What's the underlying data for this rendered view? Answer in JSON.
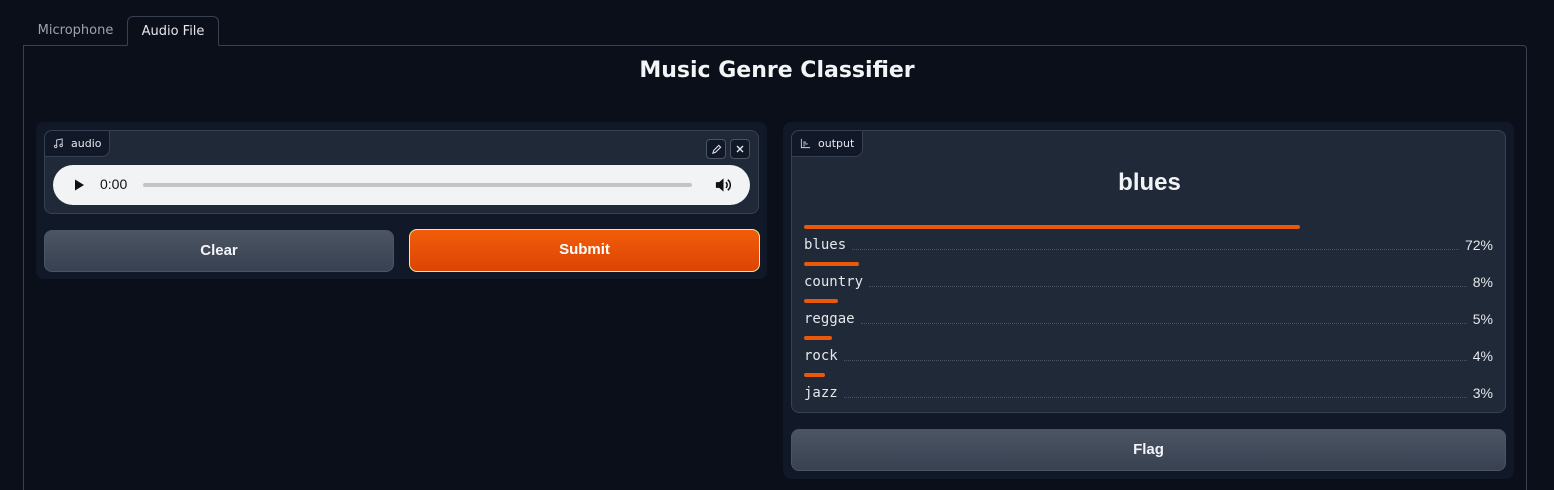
{
  "tabs": [
    {
      "label": "Microphone",
      "active": false
    },
    {
      "label": "Audio File",
      "active": true
    }
  ],
  "title": "Music Genre Classifier",
  "input": {
    "label": "audio",
    "label_icon": "music-note-icon",
    "player": {
      "time": "0:00",
      "progress": 0
    }
  },
  "buttons": {
    "clear": "Clear",
    "submit": "Submit",
    "flag": "Flag"
  },
  "output": {
    "label": "output",
    "label_icon": "bar-chart-icon",
    "predicted": "blues",
    "confidences": [
      {
        "label": "blues",
        "value": "72%",
        "fraction": 0.72
      },
      {
        "label": "country",
        "value": "8%",
        "fraction": 0.08
      },
      {
        "label": "reggae",
        "value": "5%",
        "fraction": 0.05
      },
      {
        "label": "rock",
        "value": "4%",
        "fraction": 0.04
      },
      {
        "label": "jazz",
        "value": "3%",
        "fraction": 0.03
      }
    ]
  },
  "colors": {
    "background": "#0b0f19",
    "accent": "#ea580c",
    "submit": "#f25d0a",
    "panel": "#1f2937"
  }
}
